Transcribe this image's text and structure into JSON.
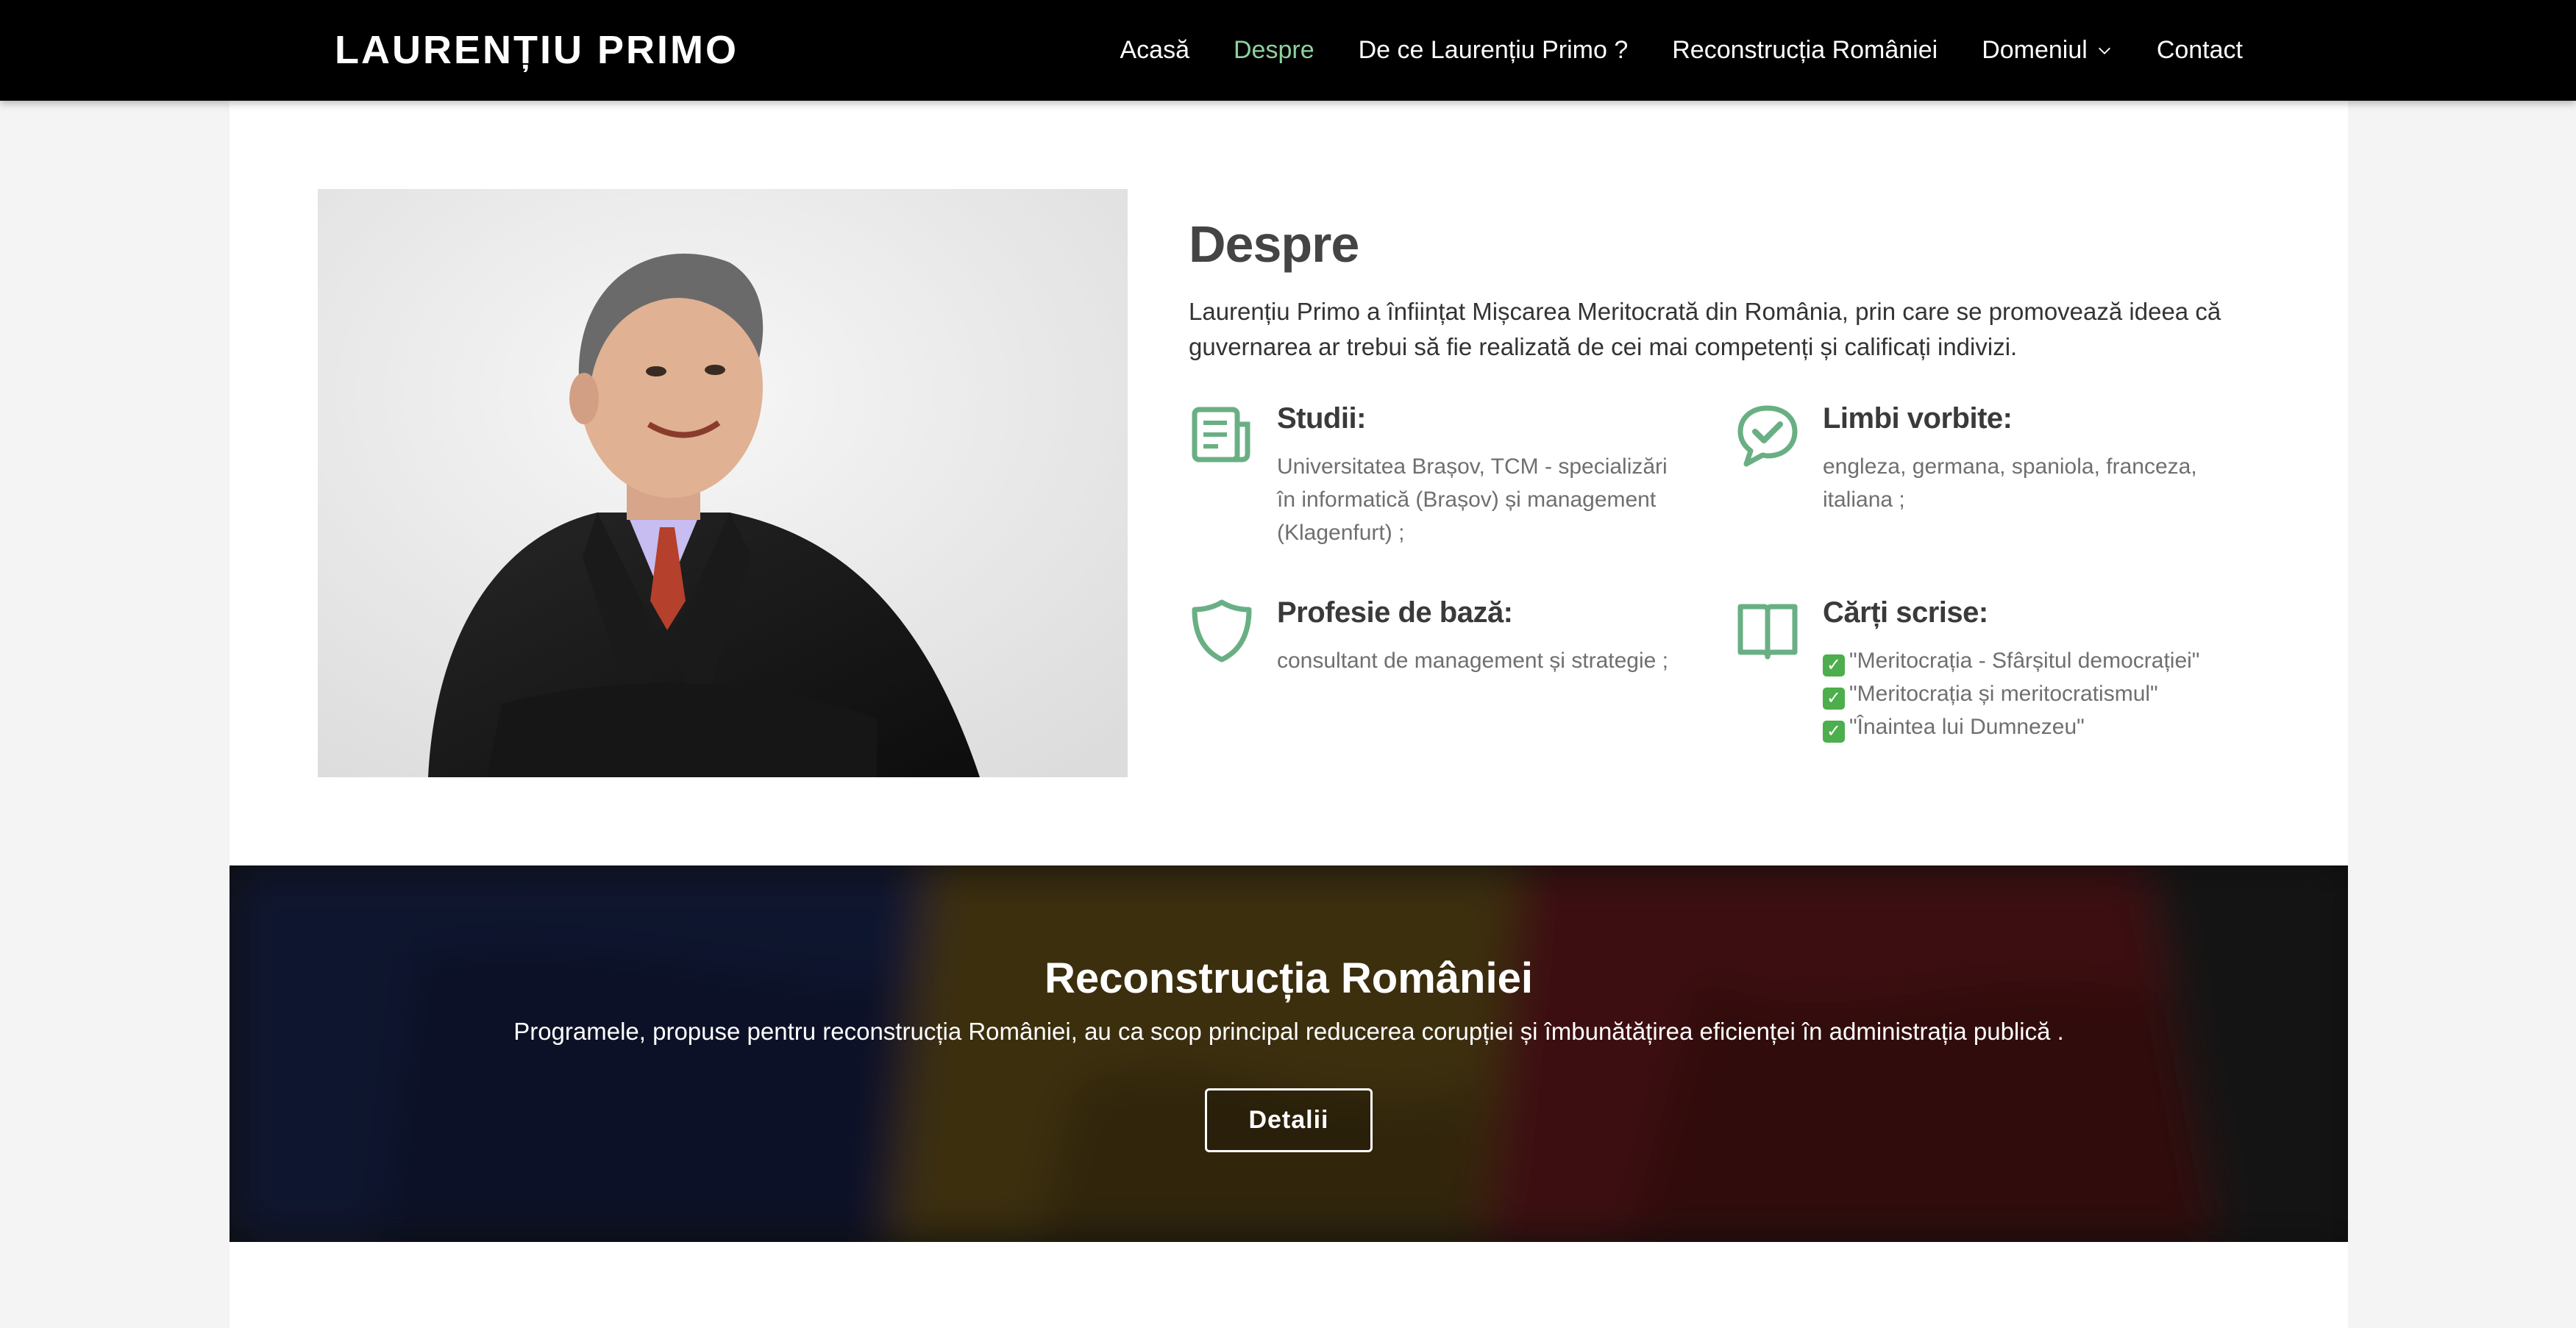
{
  "brand": "LAURENȚIU PRIMO",
  "nav": {
    "items": [
      {
        "label": "Acasă"
      },
      {
        "label": "Despre"
      },
      {
        "label": "De ce Laurențiu Primo ?"
      },
      {
        "label": "Reconstrucția României"
      },
      {
        "label": "Domeniul"
      },
      {
        "label": "Contact"
      }
    ],
    "active_index": 1
  },
  "about": {
    "title": "Despre",
    "lead": "Laurențiu Primo a înființat Mișcarea Meritocrată din România, prin care se promovează ideea că guvernarea ar trebui să fie realizată de cei mai competenți și calificați indivizi.",
    "features": {
      "studii": {
        "icon": "newspaper-icon",
        "title": "Studii:",
        "text": "Universitatea Brașov, TCM - specializări în informatică (Brașov) și management (Klagenfurt) ;"
      },
      "limbi": {
        "icon": "chat-check-icon",
        "title": "Limbi vorbite:",
        "text": "engleza, germana, spaniola, franceza, italiana ;"
      },
      "profesie": {
        "icon": "shield-icon",
        "title": "Profesie de bază:",
        "text": "consultant de management și strategie ;"
      },
      "carti": {
        "icon": "open-book-icon",
        "title": "Cărți scrise:",
        "books": [
          "\"Meritocrația - Sfârșitul democrației\"",
          "\"Meritocrația și meritocratismul\"",
          "\"Înaintea lui Dumnezeu\""
        ]
      }
    }
  },
  "banner": {
    "title": "Reconstrucția României",
    "text": "Programele, propuse pentru reconstrucția României, au ca scop principal reducerea corupției și îmbunătățirea eficienței în administrația publică .",
    "button": "Detalii"
  },
  "colors": {
    "nav_bg": "#000000",
    "accent_green": "#6aaf84",
    "active_nav": "#8fd19e"
  }
}
